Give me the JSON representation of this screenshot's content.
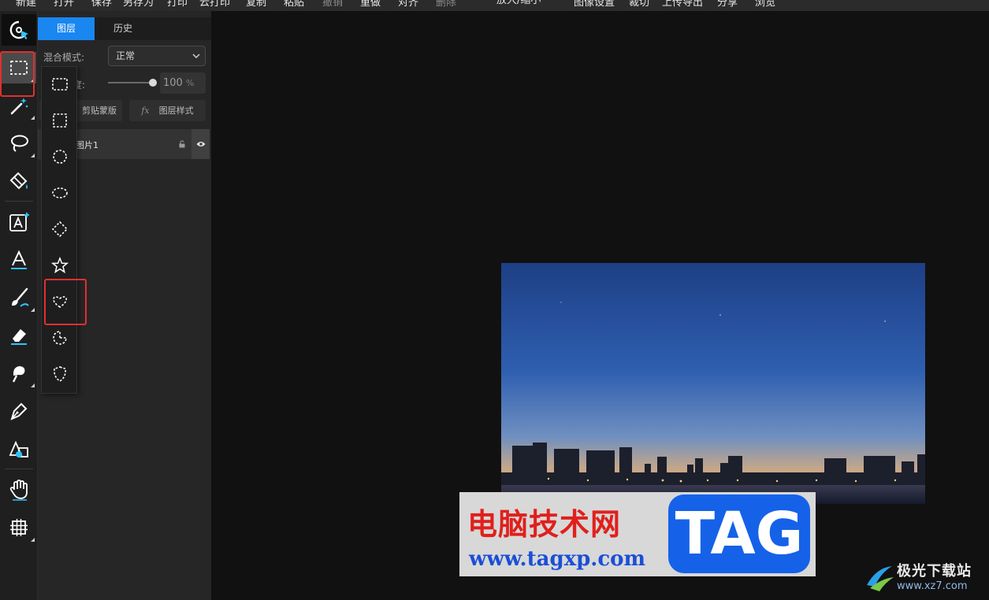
{
  "menubar": {
    "items": [
      {
        "label": "新建"
      },
      {
        "label": "打开"
      },
      {
        "label": "保存"
      },
      {
        "label": "另存为"
      },
      {
        "label": "打印"
      },
      {
        "label": "云打印"
      },
      {
        "label": "复制"
      },
      {
        "label": "粘贴"
      },
      {
        "label": "撤销",
        "disabled": true
      },
      {
        "label": "重做"
      },
      {
        "label": "对齐"
      },
      {
        "label": "删除",
        "disabled": true
      },
      {
        "label": "放大/缩小"
      },
      {
        "label": "图像设置"
      },
      {
        "label": "裁切"
      },
      {
        "label": "上传导出"
      },
      {
        "label": "分享"
      },
      {
        "label": "浏览"
      }
    ]
  },
  "toolbar": {
    "tools": [
      {
        "icon": "select-cursor-icon"
      },
      {
        "icon": "rect-marquee-icon",
        "active": true
      },
      {
        "icon": "magic-wand-icon"
      },
      {
        "icon": "lasso-icon"
      },
      {
        "icon": "paint-bucket-icon"
      },
      {
        "icon": "add-text-icon"
      },
      {
        "icon": "text-style-icon"
      },
      {
        "icon": "brush-icon"
      },
      {
        "icon": "eraser-icon"
      },
      {
        "icon": "smudge-icon"
      },
      {
        "icon": "pen-icon"
      },
      {
        "icon": "shape-icon"
      },
      {
        "icon": "hand-icon"
      },
      {
        "icon": "crop-grid-icon"
      }
    ]
  },
  "panel": {
    "tabs": [
      {
        "label": "图层",
        "active": true
      },
      {
        "label": "历史"
      }
    ],
    "blend_label": "混合模式:",
    "blend_value": "正常",
    "opacity_label": "度:",
    "opacity_value": "100",
    "opacity_unit": "%",
    "clip_mask_label": "剪贴蒙版",
    "fx_glyph": "fx",
    "layer_style_label": "图层样式",
    "layer_name": "图片1"
  },
  "flyout": {
    "shapes": [
      {
        "icon": "rect-selection-icon"
      },
      {
        "icon": "square-selection-icon"
      },
      {
        "icon": "circle-selection-icon"
      },
      {
        "icon": "ellipse-selection-icon"
      },
      {
        "icon": "diamond-selection-icon"
      },
      {
        "icon": "star-selection-icon"
      },
      {
        "icon": "heart-selection-icon",
        "highlighted": true
      },
      {
        "icon": "pie-selection-icon"
      },
      {
        "icon": "shield-selection-icon"
      }
    ]
  },
  "watermark": {
    "site_name": "电脑技术网",
    "site_url": "www.tagxp.com",
    "badge": "TAG"
  },
  "corner_logo": {
    "name": "极光下载站",
    "url": "www.xz7.com"
  },
  "colors": {
    "accent": "#1a86f0",
    "highlight_red": "#e03030"
  }
}
